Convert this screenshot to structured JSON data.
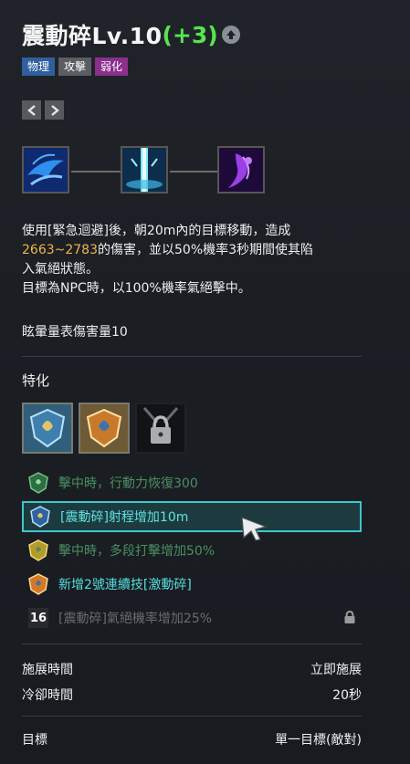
{
  "skill": {
    "name": "震動碎Lv.10",
    "bonus": "(+3)",
    "upgrade_icon": "arrow-up-circle-icon",
    "tags": [
      {
        "label": "物理",
        "color": "#2f5f9e"
      },
      {
        "label": "攻擊",
        "color": "#5a5d62"
      },
      {
        "label": "弱化",
        "color": "#8a2f8c"
      }
    ]
  },
  "nav": {
    "prev_icon": "chevron-left-icon",
    "next_icon": "chevron-right-icon"
  },
  "combo_chain": [
    "evade-dash-skill-icon",
    "lightning-pillar-skill-icon",
    "purple-strike-skill-icon"
  ],
  "description": {
    "line1": "使用[緊急迴避]後，朝20m內的目標移動，造成",
    "damage": "2663~2783",
    "line2_rest": "的傷害，並以50%機率3秒期間使其陷",
    "line3": "入氣絕狀態。",
    "line4": "目標為NPC時，以100%機率氣絕擊中。",
    "extra": "眩暈量表傷害量10"
  },
  "specialization": {
    "label": "特化",
    "slots": [
      "blue-crest-icon",
      "orange-crest-icon",
      "chain-lock-icon"
    ],
    "items": [
      {
        "text": "擊中時，行動力恢復300",
        "color": "#4b8f63",
        "icon": "green-crest-icon"
      },
      {
        "text": "[震動碎]射程增加10m",
        "color": "#5fe3e0",
        "icon": "blue-crest-icon"
      },
      {
        "text": "擊中時，多段打擊增加50%",
        "color": "#4a8f62",
        "icon": "gold-crest-icon"
      },
      {
        "text": "新增2號連續技[激動碎]",
        "color": "#55dede",
        "icon": "orange-crest-icon"
      },
      {
        "text": "[震動碎]氣絕機率增加25%",
        "color": "#686b70",
        "level": "16",
        "icon": "lock-icon"
      }
    ]
  },
  "stats": [
    {
      "label": "施展時間",
      "value": "立即施展"
    },
    {
      "label": "冷卻時間",
      "value": "20秒"
    },
    {
      "label": "目標",
      "value": "單一目標(敵對)"
    }
  ]
}
